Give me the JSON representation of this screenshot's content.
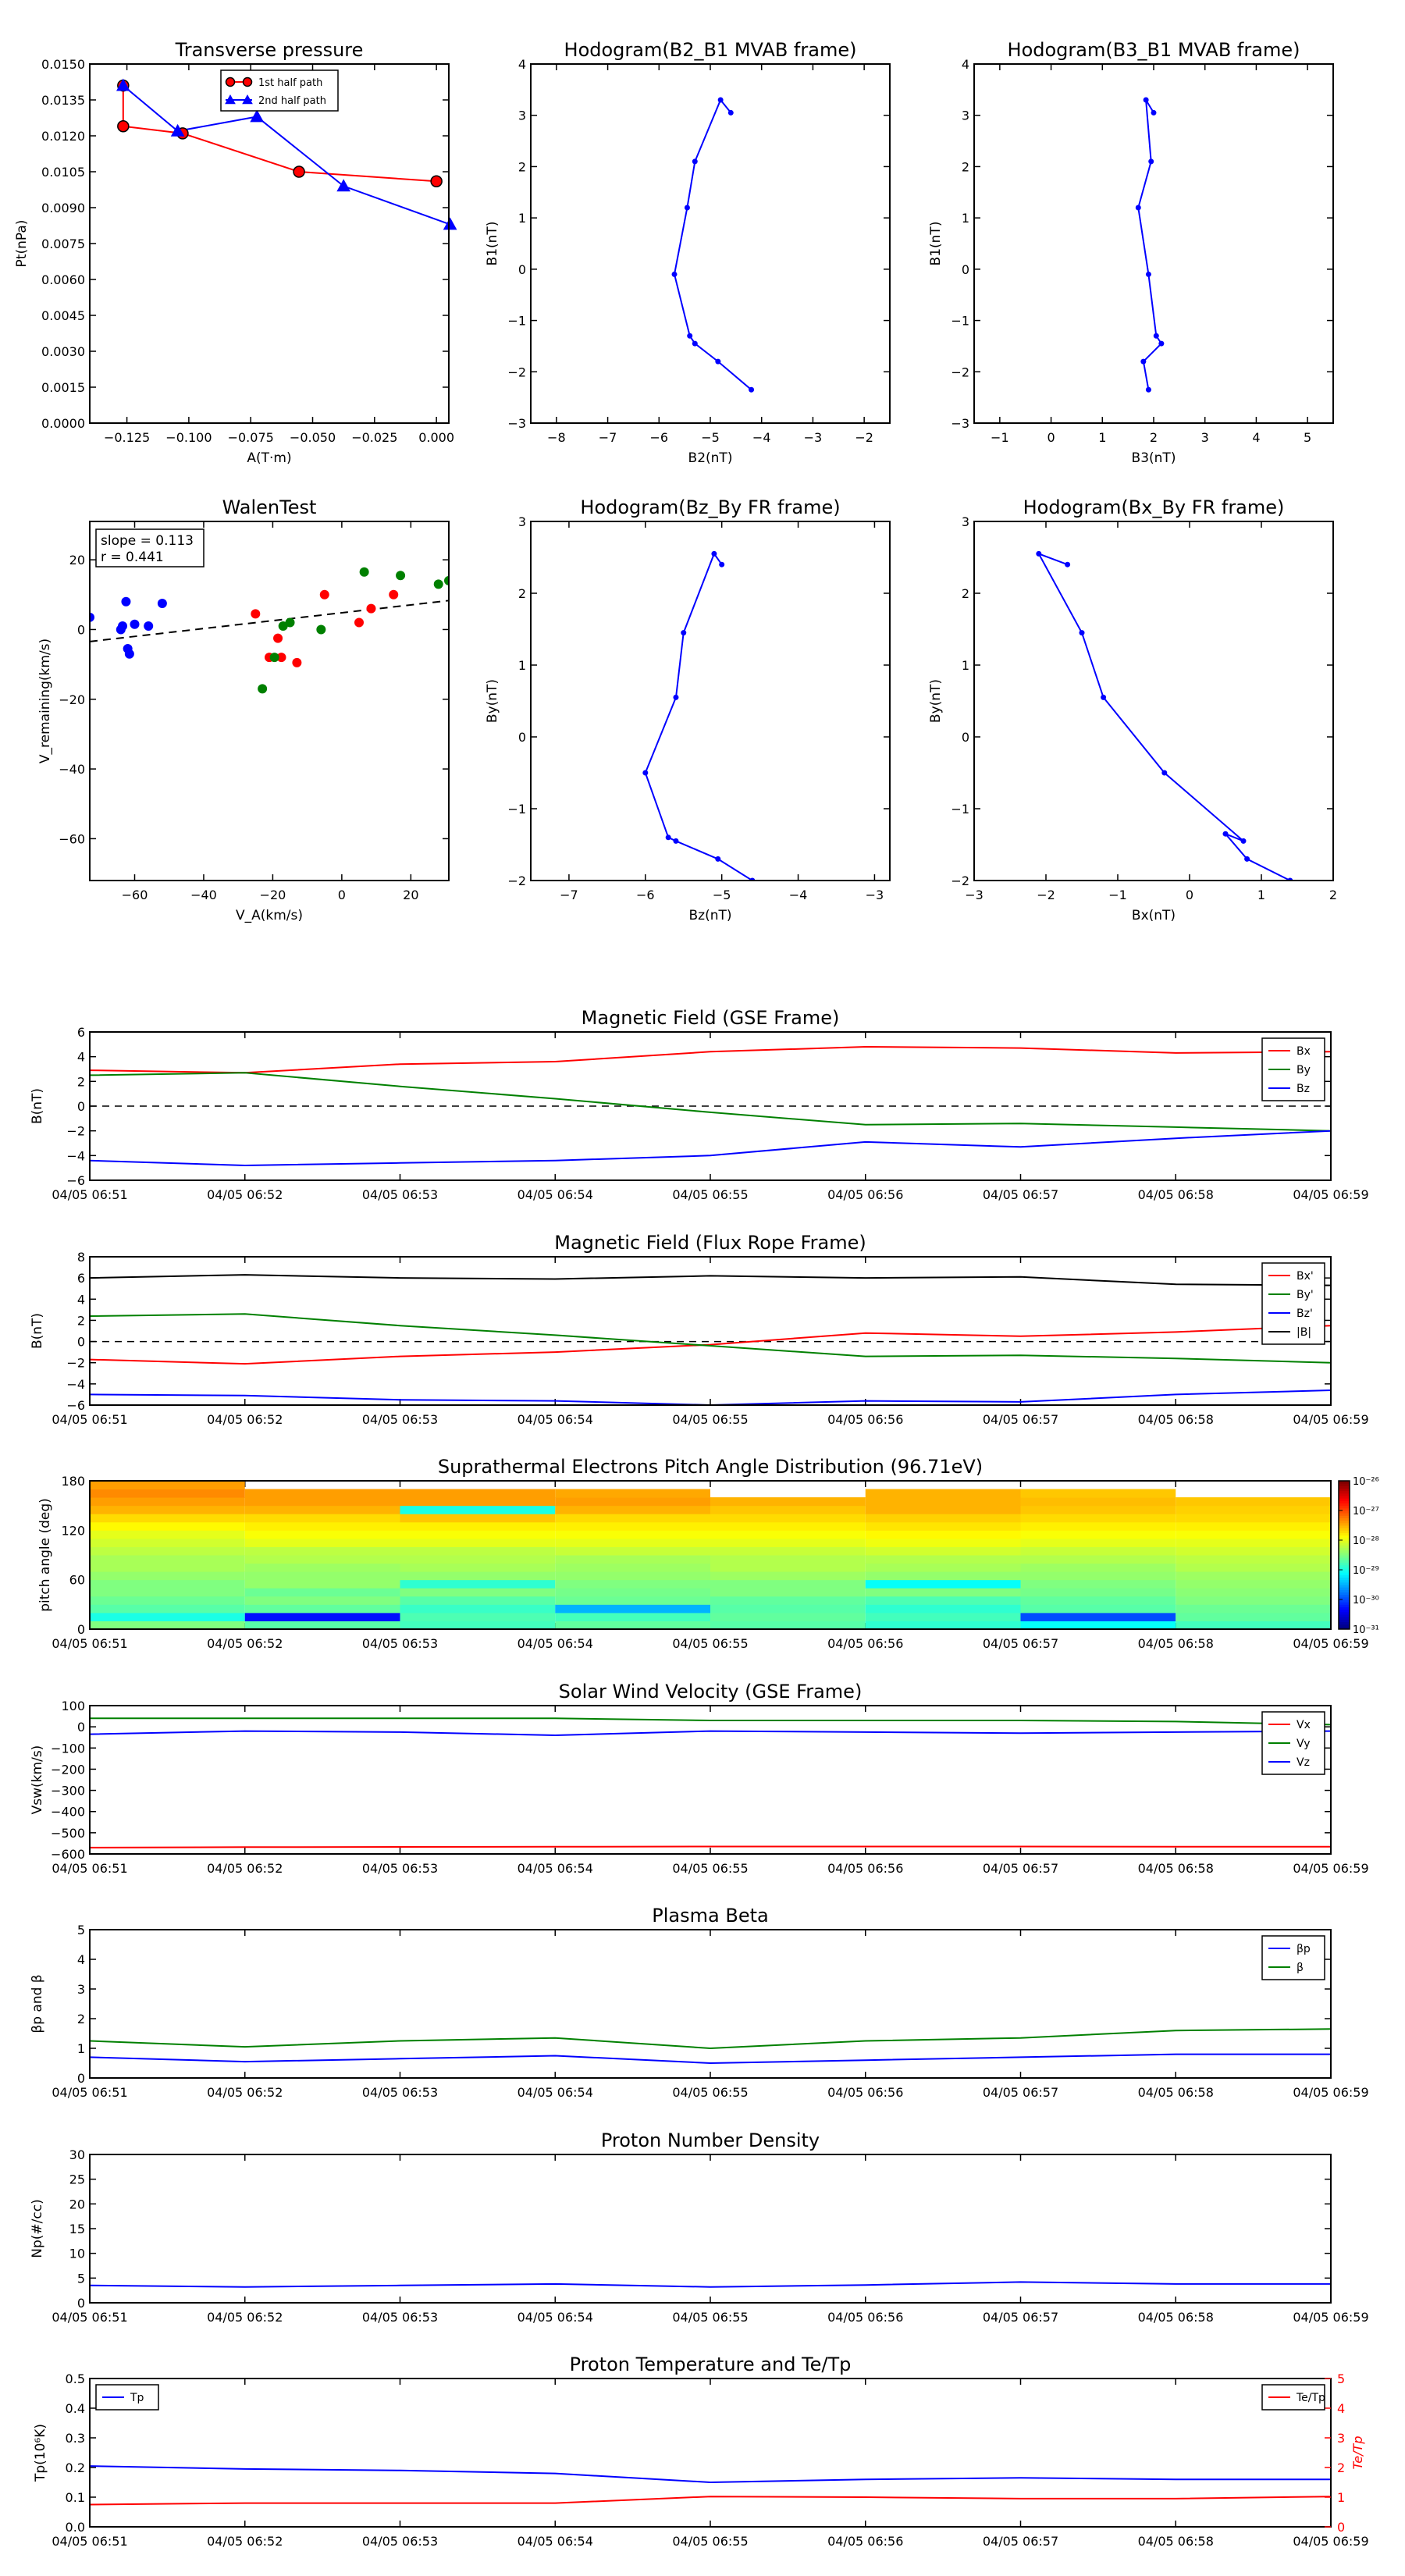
{
  "chart_data": [
    {
      "id": "pt",
      "type": "line",
      "title": "Transverse pressure",
      "xlabel": "A(T·m)",
      "ylabel": "Pt(nPa)",
      "xlim": [
        -0.14,
        0.005
      ],
      "ylim": [
        0,
        0.015
      ],
      "xticks": [
        -0.125,
        -0.1,
        -0.075,
        -0.05,
        -0.025,
        0.0
      ],
      "xticklabels": [
        "−0.125",
        "−0.100",
        "−0.075",
        "−0.050",
        "−0.025",
        "0.000"
      ],
      "yticks": [
        0,
        0.0015,
        0.003,
        0.0045,
        0.006,
        0.0075,
        0.009,
        0.0105,
        0.012,
        0.0135,
        0.015
      ],
      "yticklabels": [
        "0.0000",
        "0.0015",
        "0.0030",
        "0.0045",
        "0.0060",
        "0.0075",
        "0.0090",
        "0.0105",
        "0.0120",
        "0.0135",
        "0.0150"
      ],
      "legend": "top-center",
      "series": [
        {
          "name": "1st half path",
          "color": "#ff0000",
          "marker": "circle",
          "x": [
            -0.1265,
            -0.1265,
            -0.1025,
            -0.0555,
            0.0
          ],
          "y": [
            0.0141,
            0.0124,
            0.0121,
            0.0105,
            0.0101
          ]
        },
        {
          "name": "2nd half path",
          "color": "#0000ff",
          "marker": "triangle",
          "x": [
            -0.1265,
            -0.1045,
            -0.0725,
            -0.0375,
            0.0055
          ],
          "y": [
            0.0141,
            0.0122,
            0.0128,
            0.0099,
            0.0083
          ]
        }
      ]
    },
    {
      "id": "h21",
      "type": "line",
      "title": "Hodogram(B2_B1 MVAB frame)",
      "xlabel": "B2(nT)",
      "ylabel": "B1(nT)",
      "xlim": [
        -8.5,
        -1.5
      ],
      "ylim": [
        -3,
        4
      ],
      "xticks": [
        -8,
        -7,
        -6,
        -5,
        -4,
        -3,
        -2
      ],
      "xticklabels": [
        "−8",
        "−7",
        "−6",
        "−5",
        "−4",
        "−3",
        "−2"
      ],
      "yticks": [
        -3,
        -2,
        -1,
        0,
        1,
        2,
        3,
        4
      ],
      "yticklabels": [
        "−3",
        "−2",
        "−1",
        "0",
        "1",
        "2",
        "3",
        "4"
      ],
      "series": [
        {
          "color": "#0000ff",
          "marker": "dot",
          "x": [
            -4.6,
            -4.8,
            -5.3,
            -5.45,
            -5.7,
            -5.4,
            -5.3,
            -4.85,
            -4.2
          ],
          "y": [
            3.05,
            3.3,
            2.1,
            1.2,
            -0.1,
            -1.3,
            -1.45,
            -1.8,
            -2.35
          ]
        }
      ]
    },
    {
      "id": "h31",
      "type": "line",
      "title": "Hodogram(B3_B1 MVAB frame)",
      "xlabel": "B3(nT)",
      "ylabel": "B1(nT)",
      "xlim": [
        -1.5,
        5.5
      ],
      "ylim": [
        -3,
        4
      ],
      "xticks": [
        -1,
        0,
        1,
        2,
        3,
        4,
        5
      ],
      "xticklabels": [
        "−1",
        "0",
        "1",
        "2",
        "3",
        "4",
        "5"
      ],
      "yticks": [
        -3,
        -2,
        -1,
        0,
        1,
        2,
        3,
        4
      ],
      "yticklabels": [
        "−3",
        "−2",
        "−1",
        "0",
        "1",
        "2",
        "3",
        "4"
      ],
      "series": [
        {
          "color": "#0000ff",
          "marker": "dot",
          "x": [
            2.0,
            1.85,
            1.95,
            1.7,
            1.9,
            2.05,
            2.15,
            1.8,
            1.9
          ],
          "y": [
            3.05,
            3.3,
            2.1,
            1.2,
            -0.1,
            -1.3,
            -1.45,
            -1.8,
            -2.35
          ]
        }
      ]
    },
    {
      "id": "walen",
      "type": "scatter",
      "title": "WalenTest",
      "xlabel": "V_A(km/s)",
      "ylabel": "V_remaining(km/s)",
      "xlim": [
        -73,
        31
      ],
      "ylim": [
        -72,
        31
      ],
      "xticks": [
        -60,
        -40,
        -20,
        0,
        20
      ],
      "xticklabels": [
        "−60",
        "−40",
        "−20",
        "0",
        "20"
      ],
      "yticks": [
        -60,
        -40,
        -20,
        0,
        20
      ],
      "yticklabels": [
        "−60",
        "−40",
        "−20",
        "0",
        "20"
      ],
      "annotation": [
        "slope = 0.113",
        "r = 0.441"
      ],
      "fit": {
        "slope": 0.113,
        "intercept": 4.8
      },
      "series": [
        {
          "color": "#0000ff",
          "x": [
            -73,
            -64,
            -63.5,
            -62.5,
            -62,
            -61.5,
            -60,
            -56,
            -52
          ],
          "y": [
            3.5,
            0,
            1,
            8,
            -5.5,
            -7,
            1.5,
            1,
            7.5
          ]
        },
        {
          "color": "#ff0000",
          "x": [
            -25,
            -21,
            -17.5,
            -18.5,
            -13,
            -5,
            5,
            8.5,
            15
          ],
          "y": [
            4.5,
            -8,
            -8,
            -2.5,
            -9.5,
            10,
            2,
            6,
            10
          ]
        },
        {
          "color": "#008000",
          "x": [
            -23,
            -19.5,
            -17,
            -15,
            -6,
            6.5,
            17,
            28,
            31
          ],
          "y": [
            -17,
            -8,
            1,
            2,
            0,
            16.5,
            15.5,
            13,
            14
          ]
        }
      ]
    },
    {
      "id": "hzy",
      "type": "line",
      "title": "Hodogram(Bz_By FR frame)",
      "xlabel": "Bz(nT)",
      "ylabel": "By(nT)",
      "xlim": [
        -7.5,
        -2.8
      ],
      "ylim": [
        -2,
        3
      ],
      "xticks": [
        -7,
        -6,
        -5,
        -4,
        -3
      ],
      "xticklabels": [
        "−7",
        "−6",
        "−5",
        "−4",
        "−3"
      ],
      "yticks": [
        -2,
        -1,
        0,
        1,
        2,
        3
      ],
      "yticklabels": [
        "−2",
        "−1",
        "0",
        "1",
        "2",
        "3"
      ],
      "series": [
        {
          "color": "#0000ff",
          "marker": "dot",
          "x": [
            -5.0,
            -5.1,
            -5.5,
            -5.6,
            -6.0,
            -5.7,
            -5.6,
            -5.05,
            -4.6
          ],
          "y": [
            2.4,
            2.55,
            1.45,
            0.55,
            -0.5,
            -1.4,
            -1.45,
            -1.7,
            -2.0
          ]
        }
      ]
    },
    {
      "id": "hxy",
      "type": "line",
      "title": "Hodogram(Bx_By FR frame)",
      "xlabel": "Bx(nT)",
      "ylabel": "By(nT)",
      "xlim": [
        -3,
        2
      ],
      "ylim": [
        -2,
        3
      ],
      "xticks": [
        -3,
        -2,
        -1,
        0,
        1,
        2
      ],
      "xticklabels": [
        "−3",
        "−2",
        "−1",
        "0",
        "1",
        "2"
      ],
      "yticks": [
        -2,
        -1,
        0,
        1,
        2,
        3
      ],
      "yticklabels": [
        "−2",
        "−1",
        "0",
        "1",
        "2",
        "3"
      ],
      "series": [
        {
          "color": "#0000ff",
          "marker": "dot",
          "x": [
            -1.7,
            -2.1,
            -1.5,
            -1.2,
            -0.35,
            0.75,
            0.5,
            0.8,
            1.4
          ],
          "y": [
            2.4,
            2.55,
            1.45,
            0.55,
            -0.5,
            -1.45,
            -1.35,
            -1.7,
            -2.0
          ]
        }
      ]
    },
    {
      "id": "bgse",
      "type": "line",
      "title": "Magnetic Field (GSE Frame)",
      "ylabel": "B(nT)",
      "ylim": [
        -6,
        6
      ],
      "yticks": [
        -6,
        -4,
        -2,
        0,
        2,
        4,
        6
      ],
      "yticklabels": [
        "−6",
        "−4",
        "−2",
        "0",
        "2",
        "4",
        "6"
      ],
      "zero_line": true,
      "legend": "top-right",
      "series": [
        {
          "name": "Bx",
          "color": "#ff0000",
          "values": [
            2.9,
            2.7,
            3.4,
            3.6,
            4.4,
            4.8,
            4.7,
            4.3,
            4.4
          ]
        },
        {
          "name": "By",
          "color": "#008000",
          "values": [
            2.5,
            2.7,
            1.6,
            0.6,
            -0.5,
            -1.5,
            -1.4,
            -1.7,
            -2.0
          ]
        },
        {
          "name": "Bz",
          "color": "#0000ff",
          "values": [
            -4.4,
            -4.8,
            -4.6,
            -4.4,
            -4.0,
            -2.9,
            -3.3,
            -2.6,
            -2.0
          ]
        }
      ]
    },
    {
      "id": "bfr",
      "type": "line",
      "title": "Magnetic Field (Flux Rope Frame)",
      "ylabel": "B(nT)",
      "ylim": [
        -6,
        8
      ],
      "yticks": [
        -6,
        -4,
        -2,
        0,
        2,
        4,
        6,
        8
      ],
      "yticklabels": [
        "−6",
        "−4",
        "−2",
        "0",
        "2",
        "4",
        "6",
        "8"
      ],
      "zero_line": true,
      "legend": "top-right",
      "series": [
        {
          "name": "Bx'",
          "color": "#ff0000",
          "values": [
            -1.7,
            -2.1,
            -1.4,
            -1.0,
            -0.3,
            0.8,
            0.5,
            0.9,
            1.5
          ]
        },
        {
          "name": "By'",
          "color": "#008000",
          "values": [
            2.4,
            2.6,
            1.5,
            0.6,
            -0.4,
            -1.4,
            -1.3,
            -1.6,
            -2.0
          ]
        },
        {
          "name": "Bz'",
          "color": "#0000ff",
          "values": [
            -5.0,
            -5.1,
            -5.5,
            -5.6,
            -6.0,
            -5.6,
            -5.7,
            -5.0,
            -4.6
          ]
        },
        {
          "name": "|B|",
          "color": "#000000",
          "values": [
            6.0,
            6.3,
            6.0,
            5.9,
            6.2,
            6.0,
            6.1,
            5.4,
            5.3
          ]
        }
      ]
    },
    {
      "id": "pad",
      "type": "heatmap",
      "title": "Suprathermal Electrons Pitch Angle Distribution (96.71eV)",
      "ylabel": "pitch angle (deg)",
      "ylim": [
        0,
        180
      ],
      "yticks": [
        0,
        60,
        120,
        180
      ],
      "yticklabels": [
        "0",
        "60",
        "120",
        "180"
      ],
      "colorbar": {
        "ticklabels": [
          "10⁻³¹",
          "10⁻³⁰",
          "10⁻²⁹",
          "10⁻²⁸",
          "10⁻²⁷",
          "10⁻²⁶"
        ]
      },
      "rows": [
        [
          0.5,
          0.46,
          0.44,
          0.47,
          0.46,
          0.42,
          0.38,
          0.44,
          0.45
        ],
        [
          0.4,
          0.14,
          0.45,
          0.44,
          0.47,
          0.44,
          0.2,
          0.47,
          0.48
        ],
        [
          0.46,
          0.47,
          0.43,
          0.3,
          0.46,
          0.42,
          0.46,
          0.48,
          0.49
        ],
        [
          0.48,
          0.5,
          0.46,
          0.48,
          0.47,
          0.45,
          0.47,
          0.5,
          0.5
        ],
        [
          0.5,
          0.48,
          0.5,
          0.49,
          0.5,
          0.5,
          0.49,
          0.51,
          0.52
        ],
        [
          0.5,
          0.52,
          0.42,
          0.5,
          0.5,
          0.38,
          0.5,
          0.52,
          0.52
        ],
        [
          0.52,
          0.52,
          0.52,
          0.52,
          0.53,
          0.52,
          0.52,
          0.53,
          0.53
        ],
        [
          0.54,
          0.53,
          0.54,
          0.53,
          0.55,
          0.54,
          0.53,
          0.55,
          0.56
        ],
        [
          0.54,
          0.55,
          0.55,
          0.54,
          0.55,
          0.55,
          0.55,
          0.56,
          0.56
        ],
        [
          0.56,
          0.56,
          0.56,
          0.57,
          0.57,
          0.58,
          0.57,
          0.58,
          0.58
        ],
        [
          0.58,
          0.6,
          0.6,
          0.6,
          0.6,
          0.61,
          0.6,
          0.6,
          0.62
        ],
        [
          0.6,
          0.62,
          0.62,
          0.62,
          0.62,
          0.63,
          0.62,
          0.62,
          0.63
        ],
        [
          0.63,
          0.64,
          0.64,
          0.64,
          0.64,
          0.65,
          0.64,
          0.64,
          0.64
        ],
        [
          0.66,
          0.66,
          0.68,
          0.66,
          0.66,
          0.67,
          0.66,
          0.66,
          0.66
        ],
        [
          0.7,
          0.7,
          0.4,
          0.7,
          0.68,
          0.7,
          0.68,
          0.67,
          0.66
        ],
        [
          0.72,
          0.72,
          0.72,
          0.72,
          0.7,
          0.7,
          0.69,
          0.68,
          0.68
        ],
        [
          0.74,
          0.72,
          0.72,
          0.71,
          null,
          0.7,
          0.68,
          null,
          null
        ],
        [
          0.72,
          null,
          null,
          null,
          null,
          null,
          null,
          null,
          null
        ]
      ]
    },
    {
      "id": "vsw",
      "type": "line",
      "title": "Solar Wind Velocity (GSE Frame)",
      "ylabel": "Vsw(km/s)",
      "ylim": [
        -600,
        100
      ],
      "yticks": [
        -600,
        -500,
        -400,
        -300,
        -200,
        -100,
        0,
        100
      ],
      "yticklabels": [
        "−600",
        "−500",
        "−400",
        "−300",
        "−200",
        "−100",
        "0",
        "100"
      ],
      "legend": "top-right",
      "series": [
        {
          "name": "Vx",
          "color": "#ff0000",
          "values": [
            -570,
            -568,
            -567,
            -566,
            -565,
            -565,
            -565,
            -566,
            -566
          ]
        },
        {
          "name": "Vy",
          "color": "#008000",
          "values": [
            40,
            40,
            40,
            40,
            30,
            30,
            30,
            25,
            10
          ]
        },
        {
          "name": "Vz",
          "color": "#0000ff",
          "values": [
            -35,
            -20,
            -25,
            -40,
            -20,
            -25,
            -30,
            -25,
            -20
          ]
        }
      ]
    },
    {
      "id": "beta",
      "type": "line",
      "title": "Plasma Beta",
      "ylabel": "βp and β",
      "ylim": [
        0,
        5
      ],
      "yticks": [
        0,
        1,
        2,
        3,
        4,
        5
      ],
      "yticklabels": [
        "0",
        "1",
        "2",
        "3",
        "4",
        "5"
      ],
      "legend": "top-right",
      "series": [
        {
          "name": "βp",
          "color": "#0000ff",
          "values": [
            0.7,
            0.55,
            0.65,
            0.75,
            0.5,
            0.6,
            0.7,
            0.8,
            0.8
          ]
        },
        {
          "name": "β",
          "color": "#008000",
          "values": [
            1.25,
            1.05,
            1.25,
            1.35,
            1.0,
            1.25,
            1.35,
            1.6,
            1.65
          ]
        }
      ]
    },
    {
      "id": "np",
      "type": "line",
      "title": "Proton Number Density",
      "ylabel": "Np(#/cc)",
      "ylim": [
        0,
        30
      ],
      "yticks": [
        0,
        5,
        10,
        15,
        20,
        25,
        30
      ],
      "yticklabels": [
        "0",
        "5",
        "10",
        "15",
        "20",
        "25",
        "30"
      ],
      "series": [
        {
          "color": "#0000ff",
          "values": [
            3.5,
            3.2,
            3.5,
            3.8,
            3.2,
            3.6,
            4.2,
            3.8,
            3.8
          ]
        }
      ]
    },
    {
      "id": "tp",
      "type": "line",
      "title": "Proton Temperature and Te/Tp",
      "ylabel": "Tp(10⁶K)",
      "y2label": "Te/Tp",
      "ylim": [
        0,
        0.5
      ],
      "y2lim": [
        0,
        5
      ],
      "yticks": [
        0,
        0.1,
        0.2,
        0.3,
        0.4,
        0.5
      ],
      "yticklabels": [
        "0.0",
        "0.1",
        "0.2",
        "0.3",
        "0.4",
        "0.5"
      ],
      "y2ticks": [
        0,
        1,
        2,
        3,
        4,
        5
      ],
      "y2ticklabels": [
        "0",
        "1",
        "2",
        "3",
        "4",
        "5"
      ],
      "legend": "top-left",
      "legend2": "top-right",
      "series": [
        {
          "name": "Tp",
          "color": "#0000ff",
          "axis": "left",
          "values": [
            0.205,
            0.195,
            0.19,
            0.18,
            0.15,
            0.16,
            0.165,
            0.16,
            0.16
          ]
        },
        {
          "name": "Te/Tp",
          "color": "#ff0000",
          "axis": "right",
          "values": [
            0.75,
            0.8,
            0.8,
            0.8,
            1.02,
            1.0,
            0.95,
            0.95,
            1.02
          ]
        }
      ]
    }
  ],
  "time_axis": {
    "ticklabels": [
      "04/05 06:51",
      "04/05 06:52",
      "04/05 06:53",
      "04/05 06:54",
      "04/05 06:55",
      "04/05 06:56",
      "04/05 06:57",
      "04/05 06:58",
      "04/05 06:59"
    ]
  }
}
